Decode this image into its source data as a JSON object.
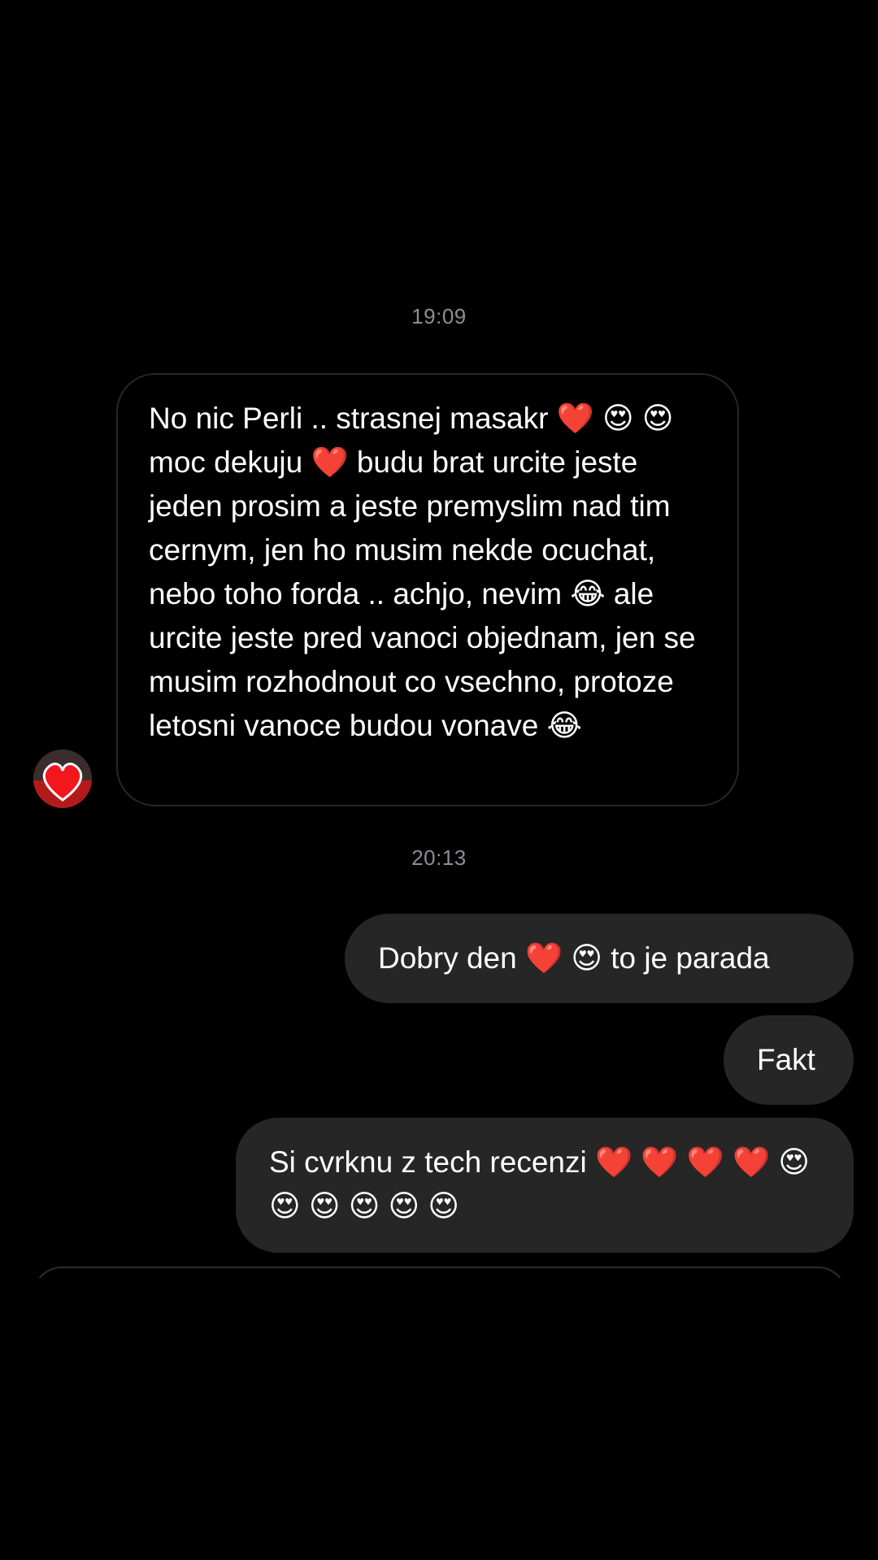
{
  "thread": {
    "timestamps": [
      "19:09",
      "20:13"
    ],
    "incoming": {
      "text": "No nic Perli .. strasnej masakr ❤️ 😍 😍 moc dekuju ❤️ budu brat urcite jeste jeden prosim a jeste premyslim nad tim cernym, jen ho musim nekde ocuchat, nebo toho forda .. achjo, nevim 😂 ale urcite jeste pred vanoci objednam, jen se musim rozhodnout co vsechno, protoze letosni vanoce budou vonave 😂",
      "avatar_icon": "heart-avatar-icon"
    },
    "outgoing": [
      {
        "text": "Dobry den ❤️ 😍  to je parada"
      },
      {
        "text": "Fakt"
      },
      {
        "text": "Si cvrknu z tech recenzi ❤️ ❤️ ❤️ ❤️ 😍 😍 😍 😍 😍 😍"
      }
    ]
  },
  "colors": {
    "background": "#000000",
    "outgoing_bubble": "#262626",
    "incoming_border": "#262626",
    "timestamp": "#8e8e93",
    "text": "#ffffff"
  }
}
